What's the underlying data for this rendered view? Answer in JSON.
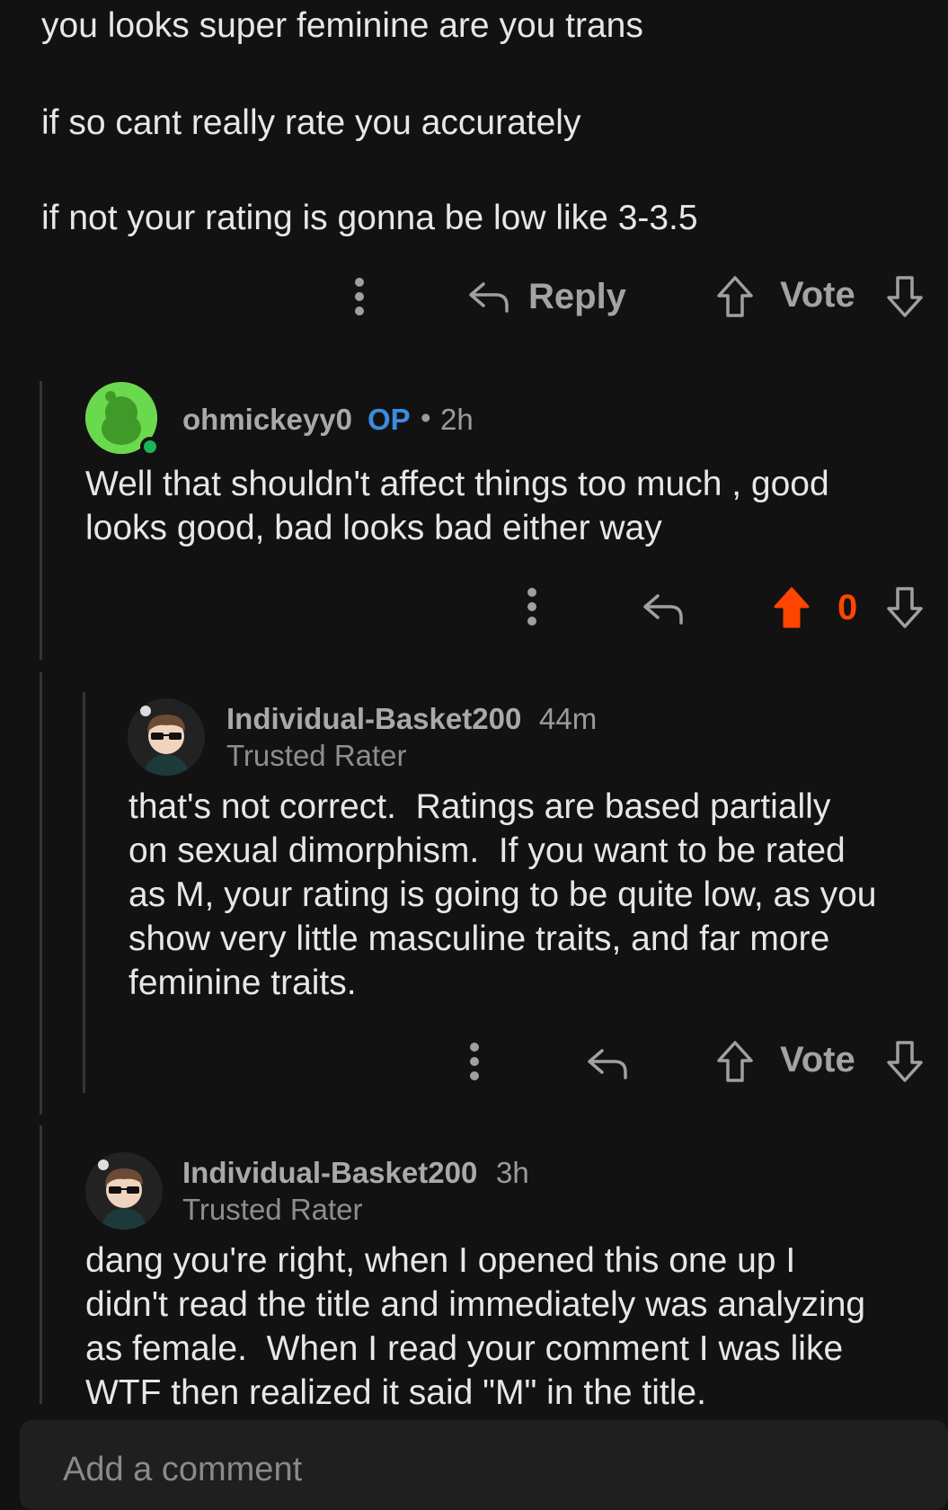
{
  "parent_comment": {
    "lines": [
      "you looks super feminine are you trans",
      "if so cant really rate you accurately",
      "if not your rating is gonna be low like 3-3.5"
    ],
    "actions": {
      "reply_label": "Reply",
      "vote_label": "Vote"
    }
  },
  "reply1": {
    "username": "ohmickeyy0",
    "op_badge": "OP",
    "separator": "•",
    "time": "2h",
    "body": "Well that shouldn't affect things too much , good\nlooks good, bad looks bad either way",
    "vote_count": "0",
    "upvoted": true,
    "upvote_color": "#ff4500"
  },
  "reply2": {
    "username": "Individual-Basket200",
    "time": "44m",
    "flair": "Trusted Rater",
    "body": "that's not correct.  Ratings are based partially\non sexual dimorphism.  If you want to be rated\nas M, your rating is going to be quite low, as you\nshow very little masculine traits, and far more\nfeminine traits.",
    "vote_label": "Vote"
  },
  "reply3": {
    "username": "Individual-Basket200",
    "time": "3h",
    "flair": "Trusted Rater",
    "body": "dang you're right, when I opened this one up I\ndidn't read the title and immediately was analyzing\nas female.  When I read your comment I was like\nWTF then realized it said \"M\" in the title."
  },
  "comment_input": {
    "placeholder": "Add a comment"
  }
}
